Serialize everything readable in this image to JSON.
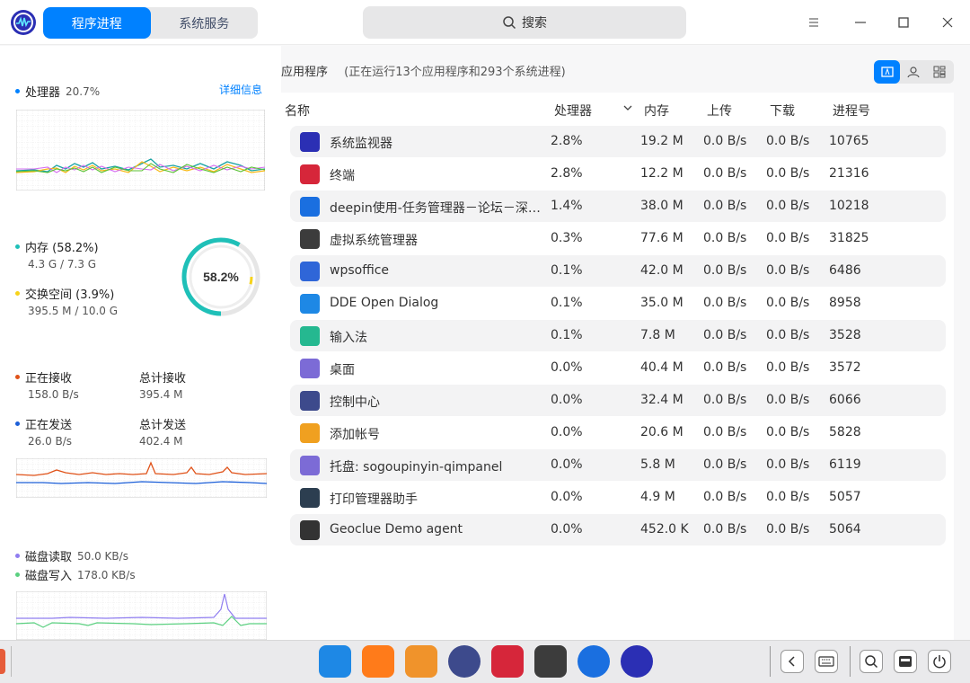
{
  "titlebar": {
    "tabs": [
      "程序进程",
      "系统服务"
    ],
    "search_label": "搜索"
  },
  "left": {
    "cpu": {
      "label": "处理器",
      "value": "20.7%",
      "detail_link": "详细信息"
    },
    "memory": {
      "label": "内存 (58.2%)",
      "value": "4.3 G / 7.3 G",
      "percent_text": "58.2%",
      "percent": 0.582,
      "swap_percent": 0.039
    },
    "swap": {
      "label": "交换空间 (3.9%)",
      "value": "395.5 M / 10.0 G"
    },
    "network": {
      "recv_label": "正在接收",
      "recv_value": "158.0 B/s",
      "total_recv_label": "总计接收",
      "total_recv_value": "395.4 M",
      "send_label": "正在发送",
      "send_value": "26.0 B/s",
      "total_send_label": "总计发送",
      "total_send_value": "402.4 M"
    },
    "disk": {
      "read_label": "磁盘读取",
      "read_value": "50.0 KB/s",
      "write_label": "磁盘写入",
      "write_value": "178.0 KB/s"
    }
  },
  "apps": {
    "title": "应用程序",
    "summary": "(正在运行13个应用程序和293个系统进程)",
    "columns": [
      "名称",
      "处理器",
      "内存",
      "上传",
      "下载",
      "进程号"
    ],
    "rows": [
      {
        "name": "系统监视器",
        "cpu": "2.8%",
        "mem": "19.2 M",
        "up": "0.0 B/s",
        "down": "0.0 B/s",
        "pid": "10765",
        "icon": "monitor-icon",
        "color": "#2b2fb4"
      },
      {
        "name": "终端",
        "cpu": "2.8%",
        "mem": "12.2 M",
        "up": "0.0 B/s",
        "down": "0.0 B/s",
        "pid": "21316",
        "icon": "terminal-icon",
        "color": "#d6263a"
      },
      {
        "name": "deepin使用-任务管理器－论坛－深…",
        "cpu": "1.4%",
        "mem": "38.0 M",
        "up": "0.0 B/s",
        "down": "0.0 B/s",
        "pid": "10218",
        "icon": "browser-icon",
        "color": "#1a6fe0"
      },
      {
        "name": "虚拟系统管理器",
        "cpu": "0.3%",
        "mem": "77.6 M",
        "up": "0.0 B/s",
        "down": "0.0 B/s",
        "pid": "31825",
        "icon": "virt-manager-icon",
        "color": "#3c3c3c"
      },
      {
        "name": "wpsoffice",
        "cpu": "0.1%",
        "mem": "42.0 M",
        "up": "0.0 B/s",
        "down": "0.0 B/s",
        "pid": "6486",
        "icon": "wps-icon",
        "color": "#2f66d8"
      },
      {
        "name": "DDE Open Dialog",
        "cpu": "0.1%",
        "mem": "35.0 M",
        "up": "0.0 B/s",
        "down": "0.0 B/s",
        "pid": "8958",
        "icon": "file-manager-icon",
        "color": "#1e88e5"
      },
      {
        "name": "输入法",
        "cpu": "0.1%",
        "mem": "7.8 M",
        "up": "0.0 B/s",
        "down": "0.0 B/s",
        "pid": "3528",
        "icon": "input-method-icon",
        "color": "#25b890"
      },
      {
        "name": "桌面",
        "cpu": "0.0%",
        "mem": "40.4 M",
        "up": "0.0 B/s",
        "down": "0.0 B/s",
        "pid": "3572",
        "icon": "desktop-settings-icon",
        "color": "#7c6bd6"
      },
      {
        "name": "控制中心",
        "cpu": "0.0%",
        "mem": "32.4 M",
        "up": "0.0 B/s",
        "down": "0.0 B/s",
        "pid": "6066",
        "icon": "control-center-icon",
        "color": "#3d4a8c"
      },
      {
        "name": "添加帐号",
        "cpu": "0.0%",
        "mem": "20.6 M",
        "up": "0.0 B/s",
        "down": "0.0 B/s",
        "pid": "5828",
        "icon": "add-account-icon",
        "color": "#f0a020"
      },
      {
        "name": "托盘: sogoupinyin-qimpanel",
        "cpu": "0.0%",
        "mem": "5.8 M",
        "up": "0.0 B/s",
        "down": "0.0 B/s",
        "pid": "6119",
        "icon": "tray-settings-icon",
        "color": "#7c6bd6"
      },
      {
        "name": "打印管理器助手",
        "cpu": "0.0%",
        "mem": "4.9 M",
        "up": "0.0 B/s",
        "down": "0.0 B/s",
        "pid": "5057",
        "icon": "printer-icon",
        "color": "#2c3e50"
      },
      {
        "name": "Geoclue Demo agent",
        "cpu": "0.0%",
        "mem": "452.0 K",
        "up": "0.0 B/s",
        "down": "0.0 B/s",
        "pid": "5064",
        "icon": "location-icon",
        "color": "#333333"
      }
    ]
  },
  "dock": {
    "apps": [
      "file-manager-icon",
      "app-store-icon",
      "image-viewer-icon",
      "control-center-icon",
      "terminal-icon",
      "virt-manager-icon",
      "browser-icon",
      "monitor-icon"
    ],
    "tray": [
      "collapse-icon",
      "keyboard-icon",
      "search-icon",
      "notification-icon",
      "power-icon"
    ]
  }
}
